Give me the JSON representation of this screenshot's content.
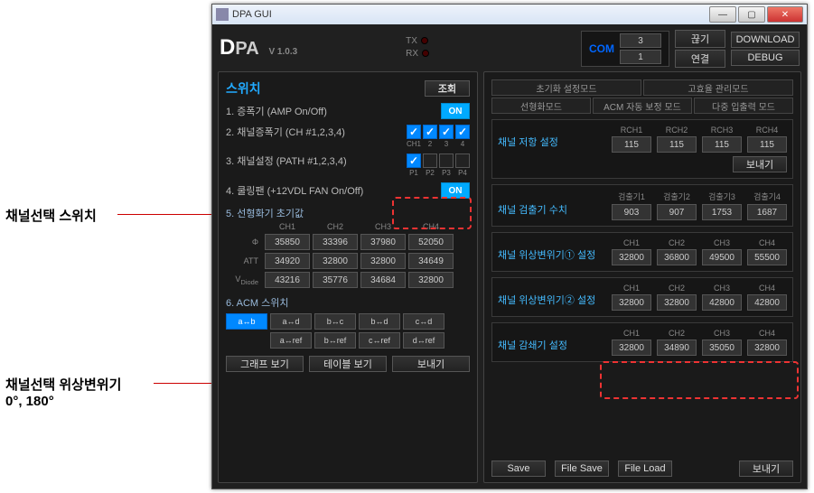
{
  "annotation1": "채널선택 스위치",
  "annotation2_line1": "채널선택 위상변위기",
  "annotation2_line2": "0°, 180°",
  "window_title": "DPA GUI",
  "logo": {
    "prefix": "D",
    "rest": "PA",
    "version": "V 1.0.3"
  },
  "txrx": {
    "tx": "TX",
    "rx": "RX"
  },
  "com": {
    "label": "COM",
    "val1": "3",
    "val2": "1"
  },
  "top_buttons": {
    "disconnect": "끊기",
    "connect": "연결",
    "download": "DOWNLOAD",
    "debug": "DEBUG"
  },
  "left": {
    "title": "스위치",
    "query_btn": "조회",
    "r1": "1. 증폭기 (AMP On/Off)",
    "r2": "2. 채널증폭기 (CH #1,2,3,4)",
    "r2_labels": [
      "CH1",
      "2",
      "3",
      "4"
    ],
    "r3": "3. 채널설정 (PATH #1,2,3,4)",
    "r3_labels": [
      "P1",
      "P2",
      "P3",
      "P4"
    ],
    "r4": "4. 쿨링팬 (+12VDL FAN On/Off)",
    "r5": "5. 선형화기 초기값",
    "grid_cols": [
      "CH1",
      "CH2",
      "CH3",
      "CH4"
    ],
    "grid_rows": {
      "Φ": [
        "35850",
        "33396",
        "37980",
        "52050"
      ],
      "ATT": [
        "34920",
        "32800",
        "32800",
        "34649"
      ],
      "VDiode": [
        "43216",
        "35776",
        "34684",
        "32800"
      ]
    },
    "r6": "6. ACM 스위치",
    "acm_row1": [
      "a↔b",
      "a↔d",
      "b↔c",
      "b↔d",
      "c↔d"
    ],
    "acm_row2": [
      "",
      "a↔ref",
      "b↔ref",
      "c↔ref",
      "d↔ref"
    ],
    "bottom": {
      "graph": "그래프 보기",
      "table": "테이블 보기",
      "send": "보내기"
    },
    "on_label": "ON"
  },
  "right": {
    "tabs_main": [
      "초기화 설정모드",
      "고효율 관리모드"
    ],
    "tabs_sub": [
      "선형화모드",
      "ACM 자동 보정 모드",
      "다중 입출력 모드"
    ],
    "g1": {
      "title": "채널 저항 설정",
      "cols": [
        "RCH1",
        "RCH2",
        "RCH3",
        "RCH4"
      ],
      "vals": [
        "115",
        "115",
        "115",
        "115"
      ],
      "send": "보내기"
    },
    "g2": {
      "title": "채널 검출기 수치",
      "cols": [
        "검출기1",
        "검출기2",
        "검출기3",
        "검출기4"
      ],
      "vals": [
        "903",
        "907",
        "1753",
        "1687"
      ]
    },
    "g3": {
      "title": "채널 위상변위기① 설정",
      "cols": [
        "CH1",
        "CH2",
        "CH3",
        "CH4"
      ],
      "vals": [
        "32800",
        "36800",
        "49500",
        "55500"
      ]
    },
    "g4": {
      "title": "채널 위상변위기② 설정",
      "cols": [
        "CH1",
        "CH2",
        "CH3",
        "CH4"
      ],
      "vals": [
        "32800",
        "32800",
        "42800",
        "42800"
      ]
    },
    "g5": {
      "title": "채널 감쇄기 설정",
      "cols": [
        "CH1",
        "CH2",
        "CH3",
        "CH4"
      ],
      "vals": [
        "32800",
        "34890",
        "35050",
        "32800"
      ]
    },
    "bottom": {
      "save": "Save",
      "file_save": "File Save",
      "file_load": "File Load",
      "send": "보내기"
    }
  }
}
